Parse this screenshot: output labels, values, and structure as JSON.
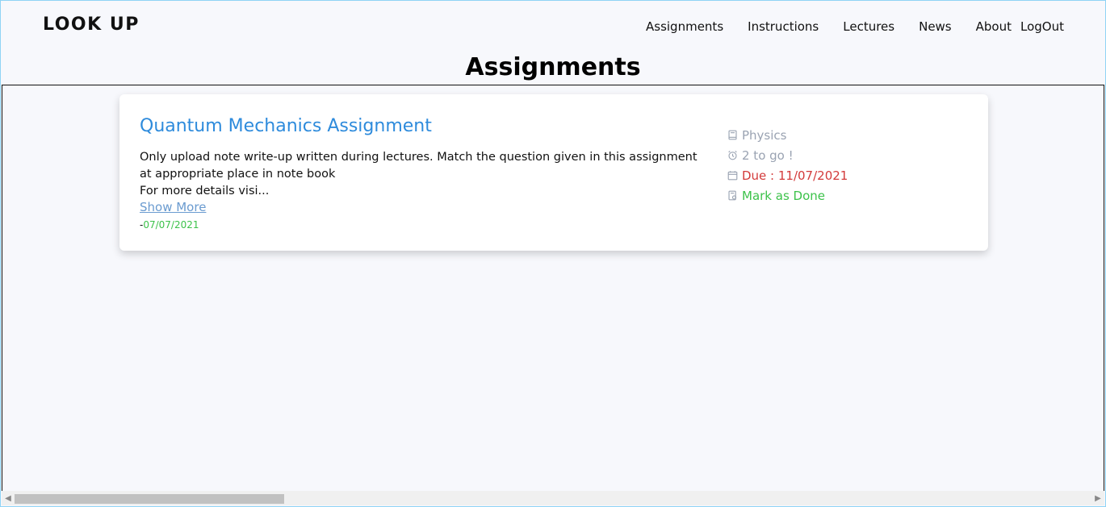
{
  "brand": "LOOK UP",
  "nav": {
    "items": [
      "Assignments",
      "Instructions",
      "Lectures",
      "News",
      "About"
    ],
    "logout": "LogOut"
  },
  "page_title": "Assignments",
  "assignment": {
    "title": "Quantum Mechanics Assignment",
    "description_line1": "Only upload note write-up written during lectures. Match the question given in this assignment at appropriate place in note book",
    "description_line2": "For more details visi...",
    "show_more": "Show More",
    "posted_prefix": "-",
    "posted_date": "07/07/2021",
    "subject": "Physics",
    "remaining": "2 to go !",
    "due": "Due : 11/07/2021",
    "mark_done": "Mark as Done"
  },
  "colors": {
    "title_blue": "#2e8bdc",
    "due_red": "#d33a3a",
    "done_green": "#3cc24a",
    "muted_gray": "#9aa3b2"
  },
  "icons": [
    "book-icon",
    "alarm-clock-icon",
    "calendar-icon",
    "checklist-icon"
  ]
}
